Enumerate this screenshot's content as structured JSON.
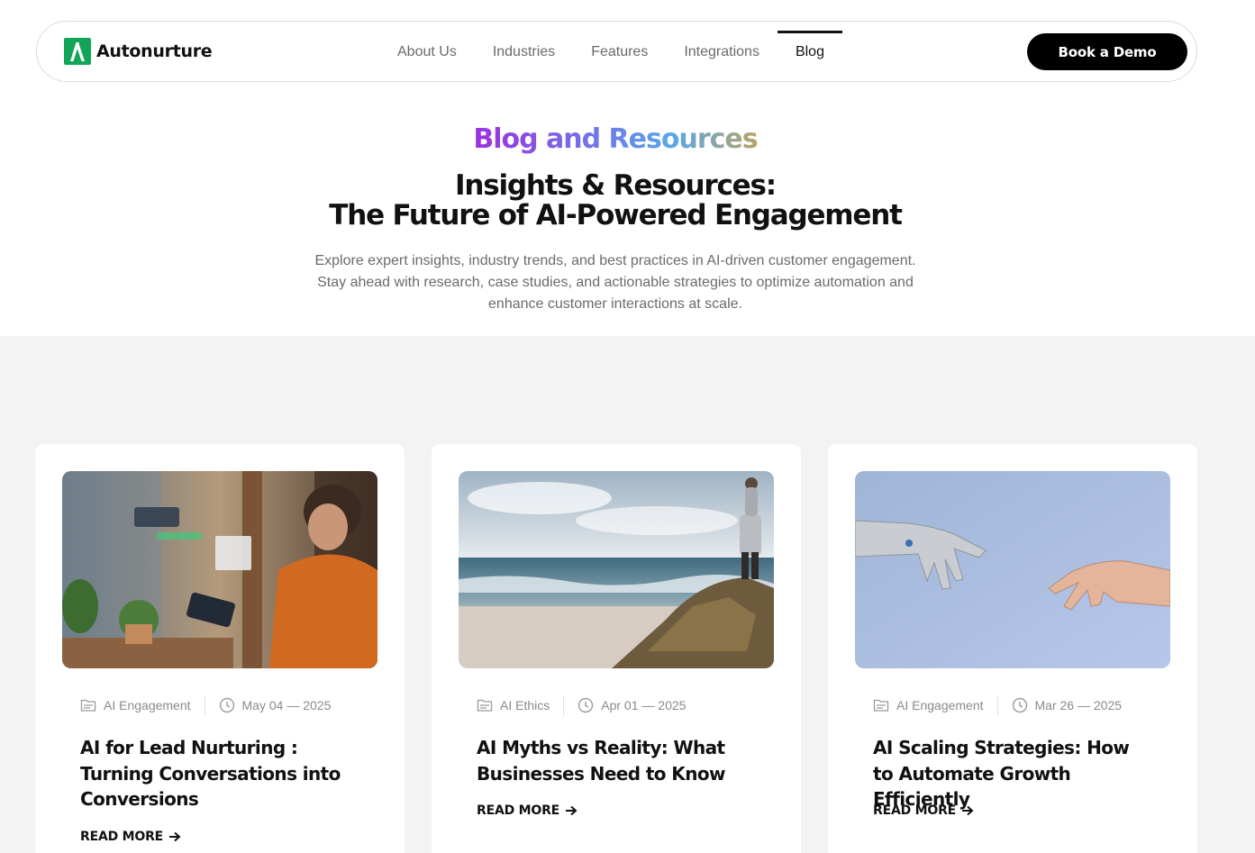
{
  "nav": {
    "brand": "Autonurture",
    "links": [
      "About Us",
      "Industries",
      "Features",
      "Integrations",
      "Blog"
    ],
    "active_link": "Blog",
    "cta": "Book a Demo"
  },
  "hero": {
    "eyebrow": "Blog and Resources",
    "headline_line1": "Insights & Resources:",
    "headline_line2": "The Future of AI-Powered Engagement",
    "intro": "Explore expert insights, industry trends, and best practices in AI-driven customer engagement. Stay ahead with research, case studies, and actionable strategies to optimize automation and enhance customer interactions at scale."
  },
  "posts": [
    {
      "category": "AI Engagement",
      "date": "May 04 — 2025",
      "title": "AI for Lead Nurturing : Turning Conversations into Conversions",
      "read_more": "READ MORE"
    },
    {
      "category": "AI Ethics",
      "date": "Apr 01 — 2025",
      "title": "AI Myths vs Reality: What Businesses Need to Know",
      "read_more": "READ MORE"
    },
    {
      "category": "AI Engagement",
      "date": "Mar 26 — 2025",
      "title": "AI Scaling Strategies: How to Automate Growth Efficiently",
      "read_more": "READ MORE"
    }
  ],
  "colors": {
    "brand_green": "#12a55a",
    "cta_bg": "#000000",
    "section_bg": "#f3f3f3",
    "gradient": [
      "#9d2fe0",
      "#6f7ae8",
      "#59a8e8",
      "#b8a467"
    ]
  },
  "icons": [
    "folder-icon",
    "clock-icon",
    "arrow-right-icon"
  ]
}
